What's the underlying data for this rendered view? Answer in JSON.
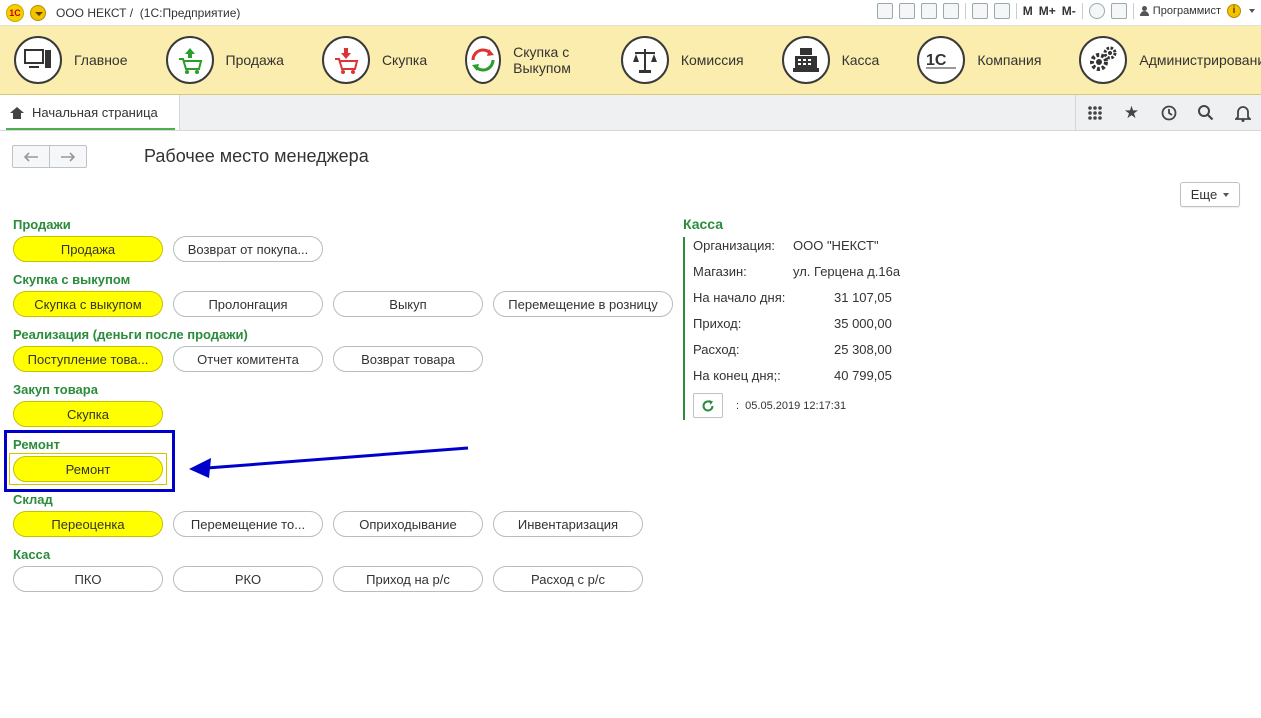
{
  "window": {
    "title": "ООО НЕКСТ /  (1С:Предприятие)",
    "logo_text": "1С",
    "toolbar": {
      "m": "M",
      "mplus": "M+",
      "mminus": "M-",
      "user": "Программист"
    }
  },
  "sections": [
    {
      "name": "main",
      "label": "Главное",
      "icon": "computer-icon"
    },
    {
      "name": "sale",
      "label": "Продажа",
      "icon": "cart-up-icon"
    },
    {
      "name": "purchase",
      "label": "Скупка",
      "icon": "cart-down-icon"
    },
    {
      "name": "buyback",
      "label": "Скупка с Выкупом",
      "icon": "cycle-icon"
    },
    {
      "name": "commission",
      "label": "Комиссия",
      "icon": "scales-icon"
    },
    {
      "name": "cash",
      "label": "Касса",
      "icon": "cash-register-icon"
    },
    {
      "name": "company",
      "label": "Компания",
      "icon": "1c-logo-icon"
    },
    {
      "name": "admin",
      "label": "Администрирование",
      "icon": "gears-icon"
    }
  ],
  "tabs": {
    "home_label": "Начальная страница"
  },
  "page": {
    "title": "Рабочее место менеджера",
    "more_label": "Еще"
  },
  "groups": {
    "sales": {
      "label": "Продажи",
      "buttons": [
        "Продажа",
        "Возврат от покупа..."
      ]
    },
    "buyback": {
      "label": "Скупка с выкупом",
      "buttons": [
        "Скупка с выкупом",
        "Пролонгация",
        "Выкуп",
        "Перемещение в розницу"
      ]
    },
    "realization": {
      "label": "Реализация (деньги после продажи)",
      "buttons": [
        "Поступление това...",
        "Отчет комитента",
        "Возврат товара"
      ]
    },
    "purchase": {
      "label": "Закуп товара",
      "buttons": [
        "Скупка"
      ]
    },
    "repair": {
      "label": "Ремонт",
      "buttons": [
        "Ремонт"
      ]
    },
    "warehouse": {
      "label": "Склад",
      "buttons": [
        "Переоценка",
        "Перемещение то...",
        "Оприходывание",
        "Инвентаризация"
      ]
    },
    "cash": {
      "label": "Касса",
      "buttons": [
        "ПКО",
        "РКО",
        "Приход на р/с",
        "Расход с р/с"
      ]
    }
  },
  "kassa": {
    "title": "Касса",
    "org_label": "Организация:",
    "org_value": "ООО \"НЕКСТ\"",
    "shop_label": "Магазин:",
    "shop_value": "ул. Герцена д.16а",
    "start_label": "На начало дня:",
    "start_value": "31 107,05",
    "income_label": "Приход:",
    "income_value": "35 000,00",
    "expense_label": "Расход:",
    "expense_value": "25 308,00",
    "end_label": "На конец дня;:",
    "end_value": "40 799,05",
    "timestamp": ":  05.05.2019 12:17:31"
  },
  "colors": {
    "accent_green": "#2a8c3c",
    "highlight_yellow": "#ffff00",
    "annotation_blue": "#0000cc",
    "sections_bg": "#fbedad"
  }
}
